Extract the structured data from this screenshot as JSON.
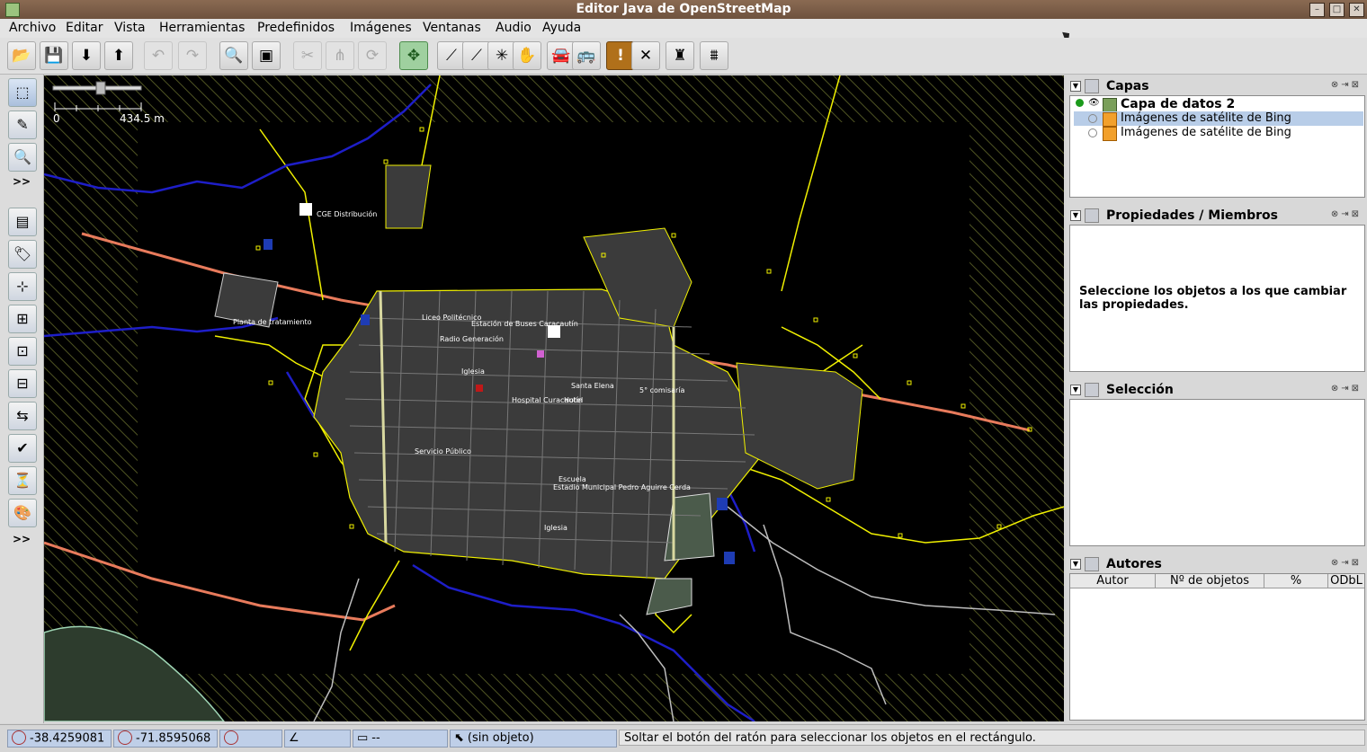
{
  "window": {
    "title": "Editor Java de OpenStreetMap"
  },
  "menu": [
    "Archivo",
    "Editar",
    "Vista",
    "Herramientas",
    "Predefinidos",
    "Imágenes",
    "Ventanas",
    "Audio",
    "Ayuda"
  ],
  "map": {
    "scale": {
      "start": "0",
      "end": "434.5 m"
    },
    "labels": [
      "CGE Distribución",
      "Planta de tratamiento",
      "Liceo Politécnico",
      "Estación de Buses Caracautín",
      "Radio Generación",
      "Iglesia",
      "Hospital Curacautín",
      "Hotel",
      "5° comisaría",
      "Santa Elena",
      "Escuela",
      "Estadio Municipal Pedro Aguirre Cerda",
      "Iglesia",
      "Servicio Público"
    ]
  },
  "panels": {
    "layers": {
      "title": "Capas",
      "items": [
        {
          "name": "Capa de datos 2"
        },
        {
          "name": "Imágenes de satélite de Bing"
        },
        {
          "name": "Imágenes de satélite de Bing"
        }
      ]
    },
    "properties": {
      "title": "Propiedades / Miembros",
      "hint": "Seleccione los objetos a los que cambiar las propiedades."
    },
    "selection": {
      "title": "Selección"
    },
    "authors": {
      "title": "Autores",
      "columns": [
        "Autor",
        "Nº de objetos",
        "%",
        "ODbL"
      ]
    }
  },
  "status": {
    "lat": "-38.4259081",
    "lon": "-71.8595068",
    "heading": "",
    "angle": "",
    "distance": "--",
    "object": "(sin objeto)",
    "message": "Soltar el botón del ratón para seleccionar los objetos en el rectángulo."
  }
}
